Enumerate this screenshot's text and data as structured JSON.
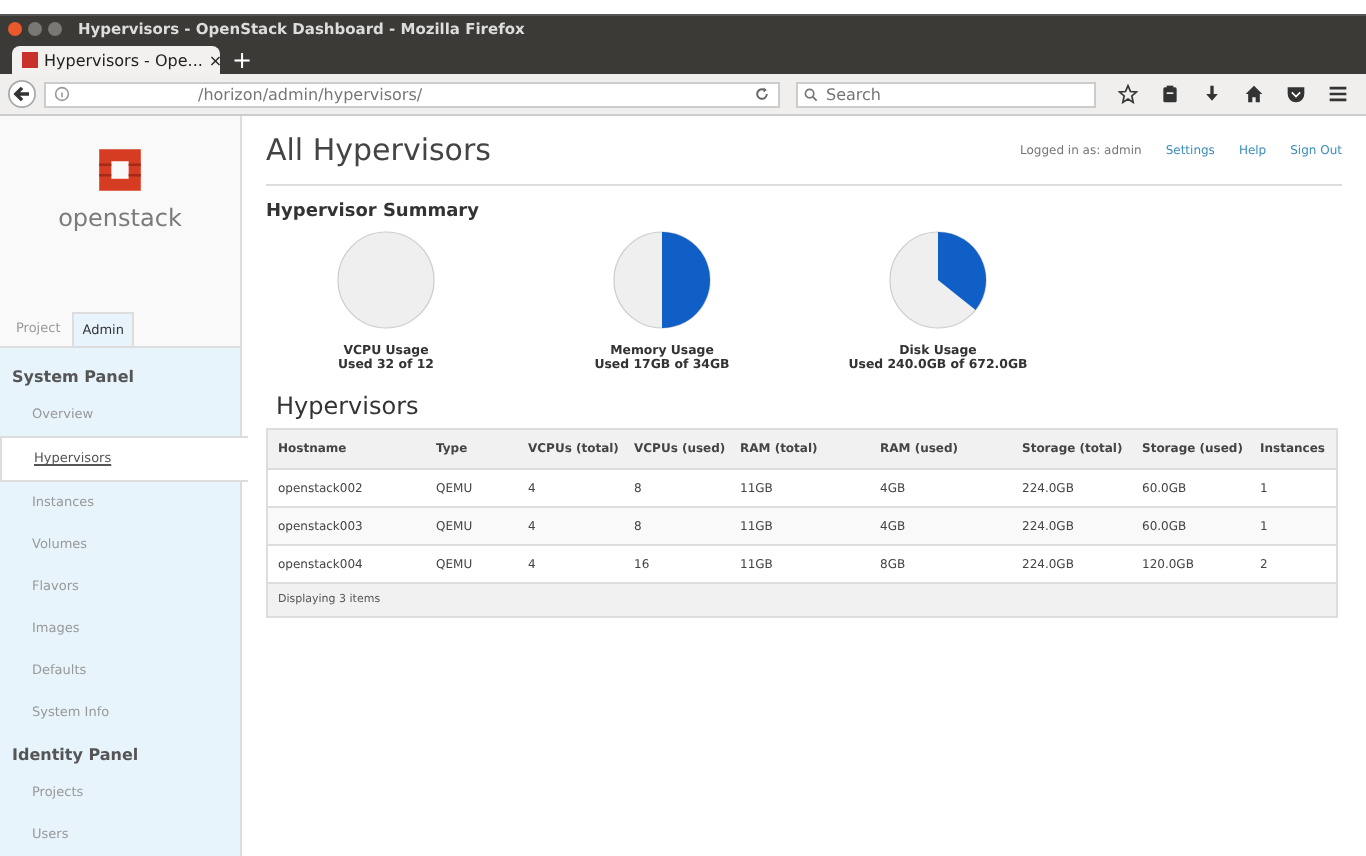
{
  "window": {
    "title": "Hypervisors - OpenStack Dashboard - Mozilla Firefox"
  },
  "browser_tabs": [
    {
      "label": "Hypervisors - Ope...",
      "close": "×",
      "selected": true
    }
  ],
  "new_tab": "+",
  "address_bar": {
    "value": "/horizon/admin/hypervisors/"
  },
  "search": {
    "placeholder": "Search"
  },
  "brand": {
    "name": "openstack"
  },
  "sidebar_tabs": [
    {
      "label": "Project",
      "selected": false
    },
    {
      "label": "Admin",
      "selected": true
    }
  ],
  "sidebar": [
    {
      "heading": "System Panel",
      "items": [
        {
          "label": "Overview",
          "selected": false
        },
        {
          "label": "Hypervisors",
          "selected": true
        },
        {
          "label": "Instances",
          "selected": false
        },
        {
          "label": "Volumes",
          "selected": false
        },
        {
          "label": "Flavors",
          "selected": false
        },
        {
          "label": "Images",
          "selected": false
        },
        {
          "label": "Defaults",
          "selected": false
        },
        {
          "label": "System Info",
          "selected": false
        }
      ]
    },
    {
      "heading": "Identity Panel",
      "items": [
        {
          "label": "Projects",
          "selected": false
        },
        {
          "label": "Users",
          "selected": false
        }
      ]
    }
  ],
  "page_title": "All Hypervisors",
  "user": {
    "logged_in": "Logged in as: admin",
    "links": [
      "Settings",
      "Help",
      "Sign Out"
    ]
  },
  "summary": {
    "title": "Hypervisor Summary",
    "usages": [
      {
        "label": "VCPU Usage",
        "detail": "Used 32 of 12"
      },
      {
        "label": "Memory Usage",
        "detail": "Used 17GB of 34GB"
      },
      {
        "label": "Disk Usage",
        "detail": "Used 240.0GB of 672.0GB"
      }
    ]
  },
  "table": {
    "title": "Hypervisors",
    "columns": [
      "Hostname",
      "Type",
      "VCPUs (total)",
      "VCPUs (used)",
      "RAM (total)",
      "RAM (used)",
      "Storage (total)",
      "Storage (used)",
      "Instances"
    ],
    "rows": [
      [
        "openstack002",
        "QEMU",
        "4",
        "8",
        "11GB",
        "4GB",
        "224.0GB",
        "60.0GB",
        "1"
      ],
      [
        "openstack003",
        "QEMU",
        "4",
        "8",
        "11GB",
        "4GB",
        "224.0GB",
        "60.0GB",
        "1"
      ],
      [
        "openstack004",
        "QEMU",
        "4",
        "16",
        "11GB",
        "8GB",
        "224.0GB",
        "120.0GB",
        "2"
      ]
    ],
    "footer": "Displaying 3 items"
  }
}
